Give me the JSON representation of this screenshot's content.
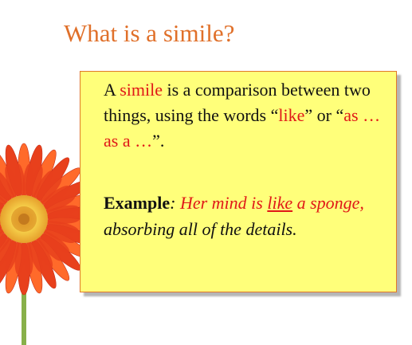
{
  "slide": {
    "title": "What is a simile?",
    "definition": {
      "part1": "A ",
      "term": "simile",
      "part2": " is a comparison between two things, using the words “",
      "keyword1": "like",
      "part3": "” or “",
      "keyword2": "as … as a …",
      "part4": "”."
    },
    "example": {
      "label": "Example",
      "colon": ": ",
      "red_part1": "Her mind is ",
      "red_keyword": "like",
      "red_part2": " a sponge,",
      "rest": " absorbing all of the details."
    },
    "image": {
      "icon": "gerbera-daisy-flower",
      "colors": {
        "petals": "#e8401c",
        "petals_highlight": "#ff6a2a",
        "center": "#f1c23a",
        "stem": "#88b04a"
      }
    },
    "colors": {
      "title": "#e0702a",
      "box_fill": "#ffff7a",
      "box_border": "#e0782a",
      "emphasis": "#e01818",
      "text": "#111111"
    }
  }
}
